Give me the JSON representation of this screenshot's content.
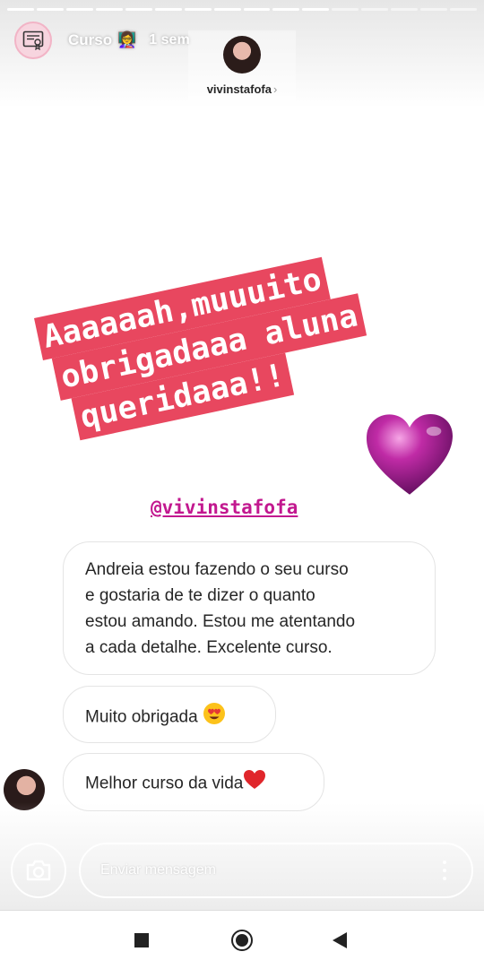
{
  "story": {
    "title": "Curso",
    "title_emoji": "👩‍🏫",
    "time_ago": "1 sem",
    "progress_total_segments": 16,
    "progress_completed_segments": 11
  },
  "mention_sticker": {
    "username": "vivinstafofa",
    "chevron": "›"
  },
  "caption": {
    "lines": [
      "Aaaaaah,muuuito",
      "obrigadaaa aluna",
      "queridaaa!!"
    ],
    "color": "#e8475f"
  },
  "heart_sticker": {
    "icon": "3d-heart-icon",
    "color": "#c2188f"
  },
  "mention_tag": "@vivinstafofa",
  "messages": [
    {
      "lines": [
        "Andreia estou fazendo o seu curso",
        "e gostaria de te dizer o quanto",
        "estou amando. Estou me atentando",
        "a cada detalhe. Excelente curso."
      ]
    },
    {
      "text": "Muito obrigada",
      "emoji": "😍"
    },
    {
      "text": "Melhor curso da vida",
      "emoji": "❤️"
    }
  ],
  "reply_bar": {
    "placeholder": "Enviar mensagem",
    "camera_icon": "camera-icon",
    "more_icon": "more-vertical-icon"
  },
  "nav_bar": {
    "recents_icon": "square-recents-icon",
    "home_icon": "circle-home-icon",
    "back_icon": "triangle-back-icon"
  }
}
